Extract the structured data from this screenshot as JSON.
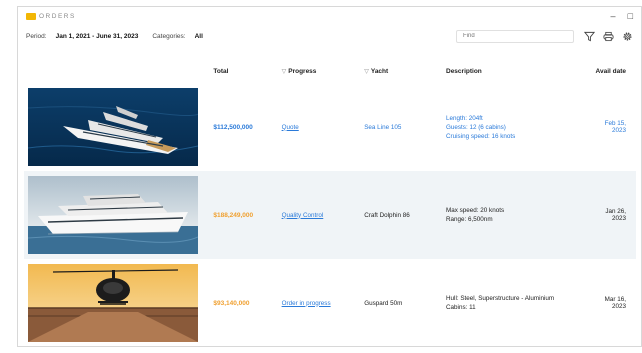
{
  "app": {
    "title": "ORDERS"
  },
  "window_controls": {
    "minimize": "–",
    "maximize": "□"
  },
  "filters": {
    "period_label": "Period:",
    "period_value": "Jan 1, 2021 - June 31, 2023",
    "categories_label": "Categories:",
    "categories_value": "All"
  },
  "search": {
    "placeholder": "Find"
  },
  "table": {
    "headers": {
      "total": "Total",
      "progress": "Progress",
      "yacht": "Yacht",
      "description": "Description",
      "avail_date": "Avail date"
    },
    "rows": [
      {
        "image": "superyacht-photo",
        "total": "$112,500,000",
        "total_color": "#2a7ad9",
        "progress": "Quote",
        "yacht": "Sea Line 105",
        "desc1": "Length: 204ft",
        "desc2": "Guests: 12 (6 cabins)",
        "desc3": "Cruising speed: 16 knots",
        "avail": "Feb 15, 2023"
      },
      {
        "image": "motor-yacht-photo",
        "total": "$188,249,000",
        "total_color": "#f0a030",
        "progress": "Quality Control",
        "yacht": "Craft Dolphin 86",
        "desc1": "Max speed: 20 knots",
        "desc2": "Range: 6,500nm",
        "desc3": "",
        "avail": "Jan 26, 2023"
      },
      {
        "image": "helicopter-deck-photo",
        "total": "$93,140,000",
        "total_color": "#f0a030",
        "progress": "Order in progress",
        "yacht": "Guspard 50m",
        "desc1": "Hull: Steel, Superstructure - Aluminium",
        "desc2": "Cabins: 11",
        "desc3": "",
        "avail": "Mar 16, 2023"
      }
    ]
  },
  "icons": [
    "filter-icon",
    "print-icon",
    "settings-icon",
    "filter-sort-icon"
  ]
}
